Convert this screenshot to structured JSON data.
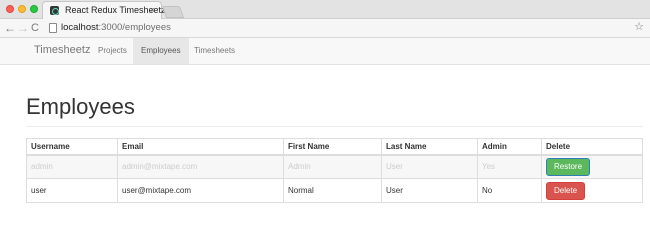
{
  "browser": {
    "tab_title": "React Redux Timesheetz",
    "tab_close": "×",
    "url_host": "localhost",
    "url_rest": ":3000/employees",
    "back": "←",
    "forward": "→",
    "reload": "C",
    "star": "☆"
  },
  "navbar": {
    "brand": "Timesheetz",
    "items": [
      {
        "label": "Projects",
        "active": false
      },
      {
        "label": "Employees",
        "active": true
      },
      {
        "label": "Timesheets",
        "active": false
      }
    ]
  },
  "page": {
    "title": "Employees"
  },
  "table": {
    "headers": [
      "Username",
      "Email",
      "First Name",
      "Last Name",
      "Admin",
      "Delete"
    ],
    "rows": [
      {
        "username": "admin",
        "email": "admin@mixtape.com",
        "first_name": "Admin",
        "last_name": "User",
        "admin": "Yes",
        "action": "Restore",
        "deleted": true
      },
      {
        "username": "user",
        "email": "user@mixtape.com",
        "first_name": "Normal",
        "last_name": "User",
        "admin": "No",
        "action": "Delete",
        "deleted": false
      }
    ]
  },
  "colors": {
    "restore": "#5cb85c",
    "delete": "#d9534f",
    "navbar_bg": "#f8f8f8"
  }
}
